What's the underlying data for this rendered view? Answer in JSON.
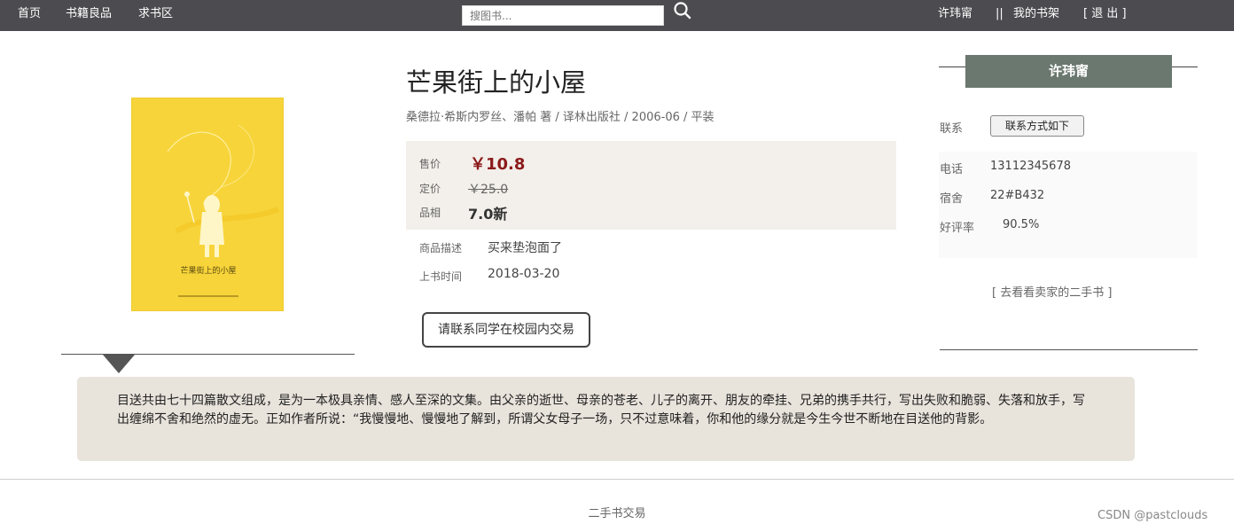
{
  "nav": {
    "home": "首页",
    "books": "书籍良品",
    "wanted": "求书区",
    "search_placeholder": "搜图书...",
    "user": "许玮甯",
    "divider": "||",
    "my_shelf": "我的书架",
    "logout": "[ 退 出 ]"
  },
  "book": {
    "title": "芒果街上的小屋",
    "meta": "桑德拉·希斯内罗丝、潘帕 著 / 译林出版社 / 2006-06 / 平装",
    "cover_title": "芒果街上的小屋"
  },
  "price": {
    "sale_label": "售价",
    "sale_value": "￥10.8",
    "list_label": "定价",
    "list_value": "￥25.0",
    "condition_label": "品相",
    "condition_value": "7.0新"
  },
  "details": {
    "desc_label": "商品描述",
    "desc_value": "买来垫泡面了",
    "date_label": "上书时间",
    "date_value": "2018-03-20",
    "contact_button": "请联系同学在校园内交易"
  },
  "seller": {
    "name": "许玮甯",
    "contact_label": "联系",
    "contact_button": "联系方式如下",
    "phone_label": "电话",
    "phone_value": "13112345678",
    "dorm_label": "宿舍",
    "dorm_value": "22#B432",
    "rating_label": "好评率",
    "rating_value": "90.5%",
    "more_books": "[ 去看看卖家的二手书 ]"
  },
  "description": "目送共由七十四篇散文组成，是为一本极具亲情、感人至深的文集。由父亲的逝世、母亲的苍老、儿子的离开、朋友的牵挂、兄弟的携手共行，写出失败和脆弱、失落和放手，写出缠绵不舍和绝然的虚无。正如作者所说：“我慢慢地、慢慢地了解到，所谓父女母子一场，只不过意味着，你和他的缘分就是今生今世不断地在目送他的背影。",
  "footer": {
    "text": "二手书交易",
    "watermark": "CSDN @pastclouds"
  },
  "colors": {
    "topbar": "#4b4b50",
    "price_red": "#8b1a1a",
    "seller_header": "#6a786f",
    "cover_yellow": "#f7d43a",
    "desc_bg": "#e8e3db"
  }
}
